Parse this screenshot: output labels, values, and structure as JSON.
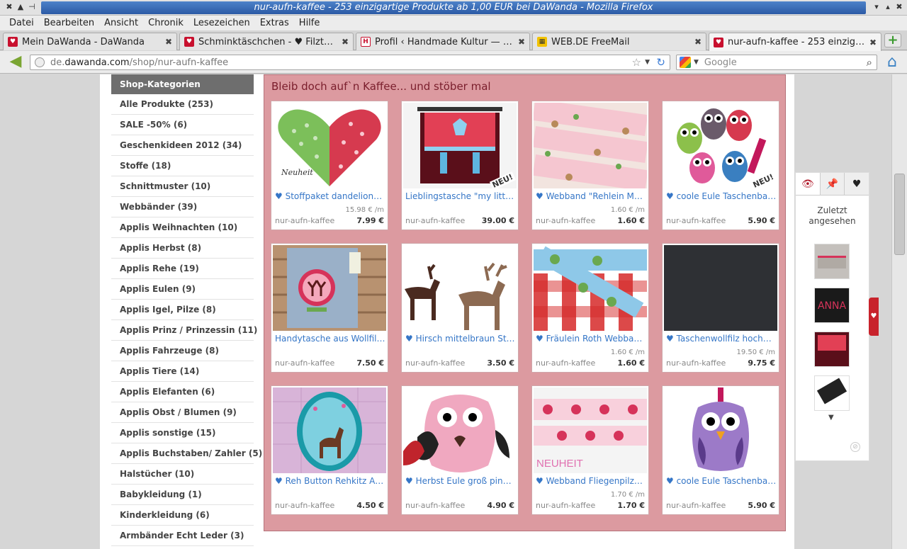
{
  "window": {
    "title": "nur-aufn-kaffee - 253 einzigartige Produkte ab 1,00 EUR bei DaWanda - Mozilla Firefox"
  },
  "menu": [
    "Datei",
    "Bearbeiten",
    "Ansicht",
    "Chronik",
    "Lesezeichen",
    "Extras",
    "Hilfe"
  ],
  "tabs": [
    {
      "label": "Mein DaWanda - DaWanda",
      "icon": "dawanda-icon"
    },
    {
      "label": "Schminktäschchen - ♥ Filztasch...",
      "icon": "dawanda-icon"
    },
    {
      "label": "Profil ‹ Handmade Kultur — Wo...",
      "icon": "handmade-icon"
    },
    {
      "label": "WEB.DE FreeMail",
      "icon": "webde-icon"
    },
    {
      "label": "nur-aufn-kaffee - 253 einzigartig...",
      "icon": "dawanda-icon"
    }
  ],
  "url": {
    "pre": "de.",
    "domain": "dawanda.com",
    "path": "/shop/nur-aufn-kaffee"
  },
  "search": {
    "placeholder": "Google"
  },
  "sidebar": {
    "header": "Shop-Kategorien",
    "items": [
      "Alle Produkte (253)",
      "SALE -50% (6)",
      "Geschenkideen 2012 (34)",
      "Stoffe (18)",
      "Schnittmuster (10)",
      "Webbänder (39)",
      "Applis Weihnachten (10)",
      "Applis Herbst (8)",
      "Applis Rehe (19)",
      "Applis Eulen (9)",
      "Applis Igel, Pilze (8)",
      "Applis Prinz / Prinzessin (11)",
      "Applis Fahrzeuge (8)",
      "Applis Tiere (14)",
      "Applis Elefanten (6)",
      "Applis Obst / Blumen (9)",
      "Applis sonstige (15)",
      "Applis Buchstaben/ Zahler (5)",
      "Halstücher (10)",
      "Babykleidung (1)",
      "Kinderkleidung (6)",
      "Armbänder Echt Leder (3)"
    ]
  },
  "main": {
    "heading": "Bleib doch auf`n Kaffee... und stöber mal",
    "products": [
      {
        "title": "♥ Stoffpaket dandelionLov...",
        "unit_price": "15.98 € /m",
        "shop": "nur-aufn-kaffee",
        "price": "7.99 €",
        "image_text": "Neuheit"
      },
      {
        "title": "Lieblingstasche \"my little ...",
        "unit_price": "",
        "shop": "nur-aufn-kaffee",
        "price": "39.00 €",
        "image_text": "NEU!"
      },
      {
        "title": "♥ Webband \"Rehlein Melli...",
        "unit_price": "1.60 € /m",
        "shop": "nur-aufn-kaffee",
        "price": "1.60 €",
        "image_text": ""
      },
      {
        "title": "♥ coole Eule Taschenbau...",
        "unit_price": "",
        "shop": "nur-aufn-kaffee",
        "price": "5.90 €",
        "image_text": "NEU!"
      },
      {
        "title": "Handytasche aus Wollfilz ...",
        "unit_price": "",
        "shop": "nur-aufn-kaffee",
        "price": "7.50 €",
        "image_text": ""
      },
      {
        "title": "♥ Hirsch mittelbraun Stick...",
        "unit_price": "",
        "shop": "nur-aufn-kaffee",
        "price": "3.50 €",
        "image_text": ""
      },
      {
        "title": "♥ Fräulein Roth Webband ...",
        "unit_price": "1.60 € /m",
        "shop": "nur-aufn-kaffee",
        "price": "1.60 €",
        "image_text": ""
      },
      {
        "title": "♥ Taschenwollfilz hochwer...",
        "unit_price": "19.50 € /m",
        "shop": "nur-aufn-kaffee",
        "price": "9.75 €",
        "image_text": ""
      },
      {
        "title": "♥ Reh Button Rehkitz Appl...",
        "unit_price": "",
        "shop": "nur-aufn-kaffee",
        "price": "4.50 €",
        "image_text": ""
      },
      {
        "title": "♥ Herbst Eule groß pink (g)♥",
        "unit_price": "",
        "shop": "nur-aufn-kaffee",
        "price": "4.90 €",
        "image_text": ""
      },
      {
        "title": "♥ Webband Fliegenpilze P...",
        "unit_price": "1.70 € /m",
        "shop": "nur-aufn-kaffee",
        "price": "1.70 €",
        "image_text": "NEUHEIT"
      },
      {
        "title": "♥ coole Eule Taschenbau...",
        "unit_price": "",
        "shop": "nur-aufn-kaffee",
        "price": "5.90 €",
        "image_text": ""
      }
    ]
  },
  "recent": {
    "label_line1": "Zuletzt",
    "label_line2": "angesehen",
    "thumb2_text": "ANNA"
  },
  "colors": {
    "brand": "#c8102e",
    "page_bg": "#dc9aa0",
    "link": "#3576c7"
  }
}
